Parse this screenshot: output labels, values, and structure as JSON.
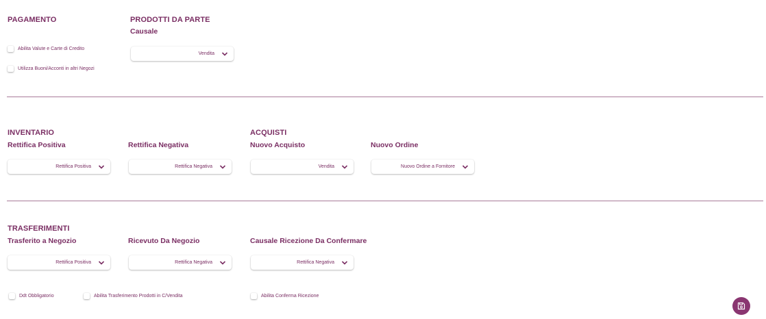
{
  "pagamento": {
    "title": "PAGAMENTO",
    "check_valute": "Abilita Valute e Carte di Credito",
    "check_buoni": "Utilizza Buoni/Acconti in altri Negozi"
  },
  "prodotti": {
    "title": "PRODOTTI DA PARTE",
    "causale_label": "Causale",
    "causale_value": "Vendita"
  },
  "inventario": {
    "title": "INVENTARIO",
    "positiva_label": "Rettifica Positiva",
    "positiva_value": "Rettifica Positiva",
    "negativa_label": "Rettifica Negativa",
    "negativa_value": "Rettifica Negativa"
  },
  "acquisti": {
    "title": "ACQUISTI",
    "nuovo_acquisto_label": "Nuovo Acquisto",
    "nuovo_acquisto_value": "Vendita",
    "nuovo_ordine_label": "Nuovo Ordine",
    "nuovo_ordine_value": "Nuovo Ordine a Fornitore"
  },
  "trasferimenti": {
    "title": "TRASFERIMENTI",
    "trasferito_label": "Trasferito a Negozio",
    "trasferito_value": "Rettifica Positiva",
    "ricevuto_label": "Ricevuto Da Negozio",
    "ricevuto_value": "Rettifica Negativa",
    "causale_ricezione_label": "Causale Ricezione Da Confermare",
    "causale_ricezione_value": "Rettifica Negativa",
    "check_ddt": "Ddt Obbligatorio",
    "check_trasf_prodotti": "Abilita Trasferimento Prodotti in C/Vendita",
    "check_conferma": "Abilita Conferma Ricezione"
  },
  "theme": {
    "accent": "#7a2e63",
    "button": "#8a3671"
  },
  "icons": {
    "dropdown": "chevron-down-icon",
    "save": "save-icon"
  }
}
